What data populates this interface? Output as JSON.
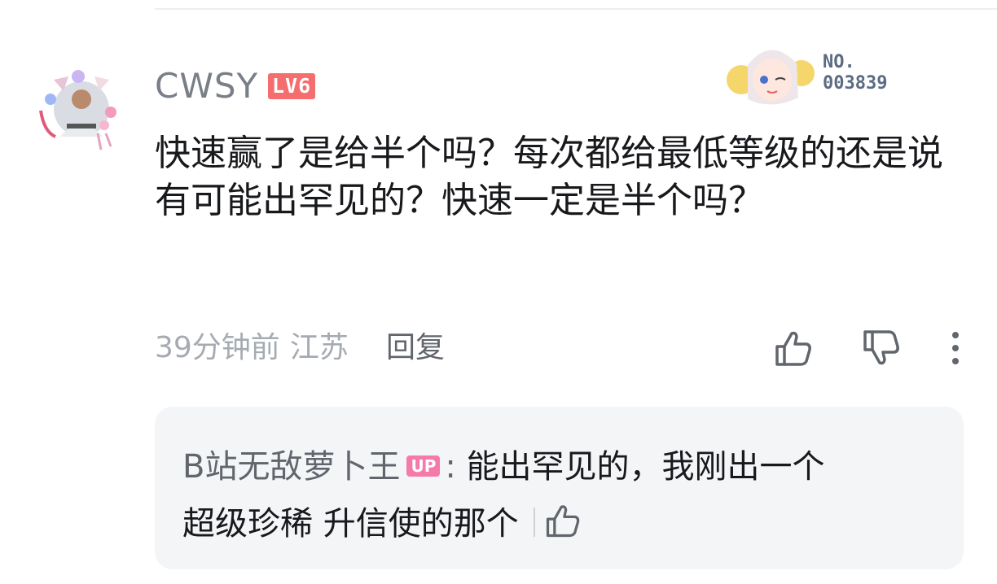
{
  "comment": {
    "username": "CWSY",
    "level": "LV6",
    "fan_badge": {
      "label": "NO.",
      "number": "003839"
    },
    "text": "快速赢了是给半个吗？每次都给最低等级的还是说有可能出罕见的？快速一定是半个吗？",
    "time": "39分钟前",
    "location": "江苏",
    "reply_label": "回复",
    "icons": [
      "thumbs-up-icon",
      "thumbs-down-icon",
      "more-vertical-icon"
    ]
  },
  "reply": {
    "username": "B站无敌萝卜王",
    "up_badge": "UP",
    "separator": ":",
    "text_line1": "能出罕见的，我刚出一个",
    "text_line2": "超级珍稀 升信使的那个"
  },
  "colors": {
    "username": "#7a7f87",
    "level_badge": "#f56d6d",
    "up_badge": "#f57aaa",
    "meta": "#a6abb2",
    "reply_bg": "#f4f5f7"
  }
}
